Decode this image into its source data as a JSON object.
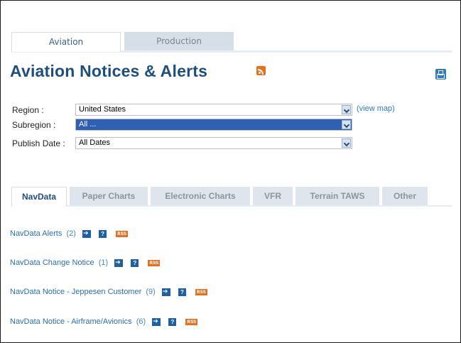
{
  "top_tabs": [
    {
      "label": "Aviation",
      "active": true
    },
    {
      "label": "Production",
      "active": false
    }
  ],
  "page_title": "Aviation Notices & Alerts",
  "filters": {
    "region": {
      "label": "Region :",
      "value": "United States",
      "link": "(view map)"
    },
    "subregion": {
      "label": "Subregion :",
      "value": "All ..."
    },
    "publish_date": {
      "label": "Publish Date :",
      "value": "All Dates"
    }
  },
  "sub_tabs": [
    {
      "label": "NavData",
      "active": true
    },
    {
      "label": "Paper Charts",
      "active": false
    },
    {
      "label": "Electronic Charts",
      "active": false
    },
    {
      "label": "VFR",
      "active": false
    },
    {
      "label": "Terrain TAWS",
      "active": false
    },
    {
      "label": "Other",
      "active": false
    }
  ],
  "alerts": [
    {
      "label": "NavData Alerts",
      "count": "(2)"
    },
    {
      "label": "NavData Change Notice",
      "count": "(1)"
    },
    {
      "label": "NavData Notice - Jeppesen Customer",
      "count": "(9)"
    },
    {
      "label": "NavData Notice - Airframe/Avionics",
      "count": "(6)"
    }
  ],
  "icons": {
    "rss_label": "RSS",
    "help_label": "?"
  },
  "colors": {
    "title": "#1d4f7c",
    "link": "#2b6fa8",
    "rss": "#e5701e",
    "highlight": "#2f5fb3"
  }
}
